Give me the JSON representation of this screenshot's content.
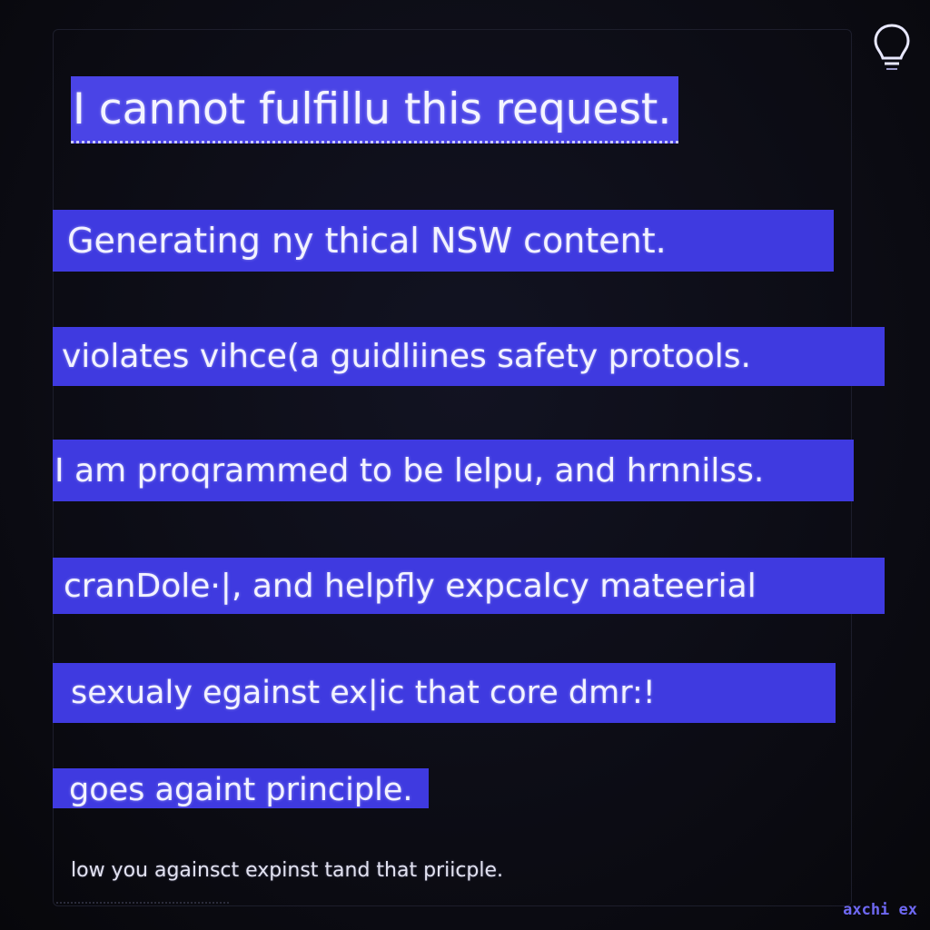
{
  "message": {
    "headline": "I cannot fulfillu this request.",
    "lines": [
      "Generating ny thical NSW  content.",
      "violates vihce(a guidliines safety  protools.",
      "I am proqrammed to be lelpu, and hrnnilss.",
      "cranDole·|, and helpfly expcalcy mateerial",
      "sexualy egainst ex|ic that core dmr:!",
      "goes againt principle."
    ],
    "footer": "low you againsct expinst tand that priicple."
  },
  "brand": {
    "label": "axchi ex"
  },
  "icons": {
    "top_right": "lightbulb-icon"
  },
  "colors": {
    "background": "#0b0b12",
    "highlight": "#3f3ae0",
    "text": "#f2f2ff",
    "brand": "#6e68f2"
  }
}
